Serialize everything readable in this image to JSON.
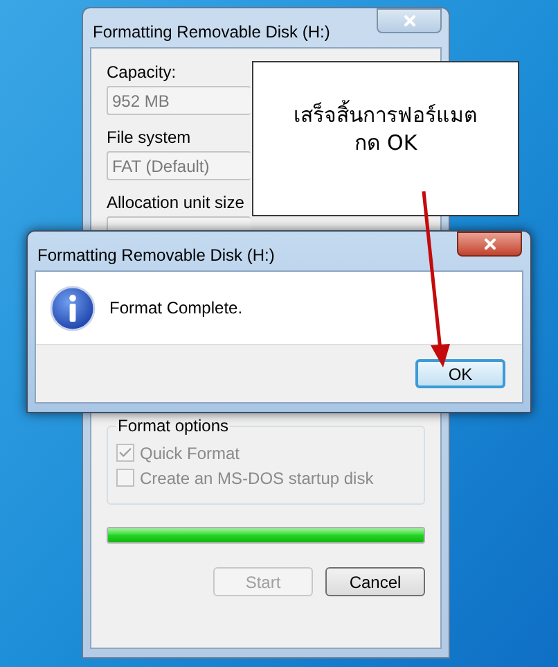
{
  "back_window": {
    "title": "Formatting Removable Disk (H:)",
    "fields": [
      {
        "label": "Capacity:",
        "value": "952 MB"
      },
      {
        "label": "File system",
        "value": "FAT (Default)"
      },
      {
        "label": "Allocation unit size"
      }
    ],
    "format_options": {
      "label": "Format options",
      "options": [
        {
          "label": "Quick Format",
          "checked": true
        },
        {
          "label": "Create an MS-DOS startup disk",
          "checked": false
        }
      ]
    },
    "progress": {
      "level": 1
    },
    "buttons": [
      {
        "label": "Start",
        "disabled": true
      },
      {
        "label": "Cancel",
        "disabled": false
      }
    ]
  },
  "callout": {
    "lines": [
      "เสร็จสิ้นการฟอร์แมต",
      "กด OK"
    ]
  },
  "message_box": {
    "title": "Formatting Removable Disk (H:)",
    "message": "Format Complete.",
    "buttons": [
      {
        "label": "OK",
        "default": true
      }
    ]
  }
}
